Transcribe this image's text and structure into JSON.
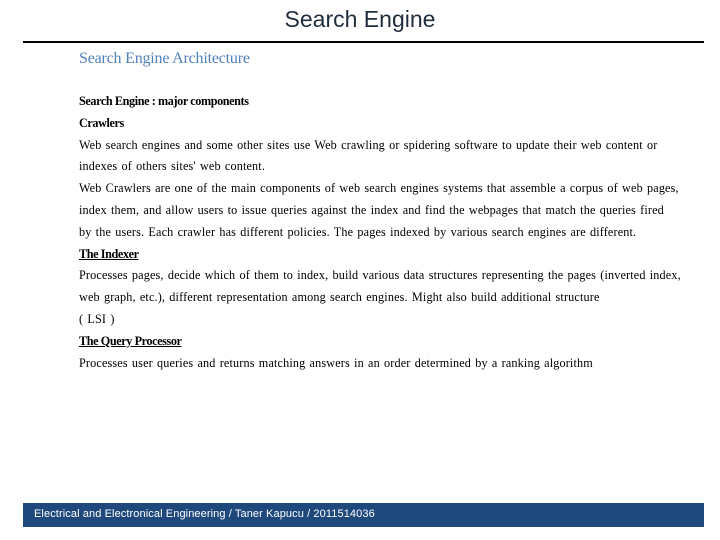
{
  "slide": {
    "title": "Search Engine",
    "subtitle": "Search Engine Architecture"
  },
  "content": {
    "lines": [
      {
        "text": "Search Engine : major components",
        "style": "heading"
      },
      {
        "text": "Crawlers",
        "style": "heading"
      },
      {
        "text": "Web search engines and some other sites use Web crawling or spidering software to update their web content or",
        "style": "body"
      },
      {
        "text": "indexes of others sites' web content.",
        "style": "body"
      },
      {
        "text": "Web Crawlers are one of the main components of web search engines systems that assemble a corpus of web pages,",
        "style": "body"
      },
      {
        "text": "index them, and allow users to issue queries against the index and find the webpages that match the queries fired",
        "style": "body"
      },
      {
        "text": "by the users. Each crawler has different policies. The pages indexed by various search engines are different.",
        "style": "body"
      },
      {
        "text": "The Indexer",
        "style": "heading-underline"
      },
      {
        "text": "Processes pages, decide which of them to index, build various data structures representing the pages (inverted index,",
        "style": "body"
      },
      {
        "text": "web graph, etc.), different representation among search engines. Might also build additional structure",
        "style": "body"
      },
      {
        "text": "( LSI )",
        "style": "body"
      },
      {
        "text": "The Query Processor",
        "style": "heading-underline"
      },
      {
        "text": "Processes user queries and returns matching answers in an order determined by a ranking algorithm",
        "style": "body"
      }
    ]
  },
  "footer": {
    "text": "Electrical and Electronical Engineering / Taner Kapucu /  2011514036",
    "background_color": "#1f497d"
  },
  "colors": {
    "title": "#1f2d3d",
    "subtitle": "#4f81bd",
    "body": "#000000"
  }
}
